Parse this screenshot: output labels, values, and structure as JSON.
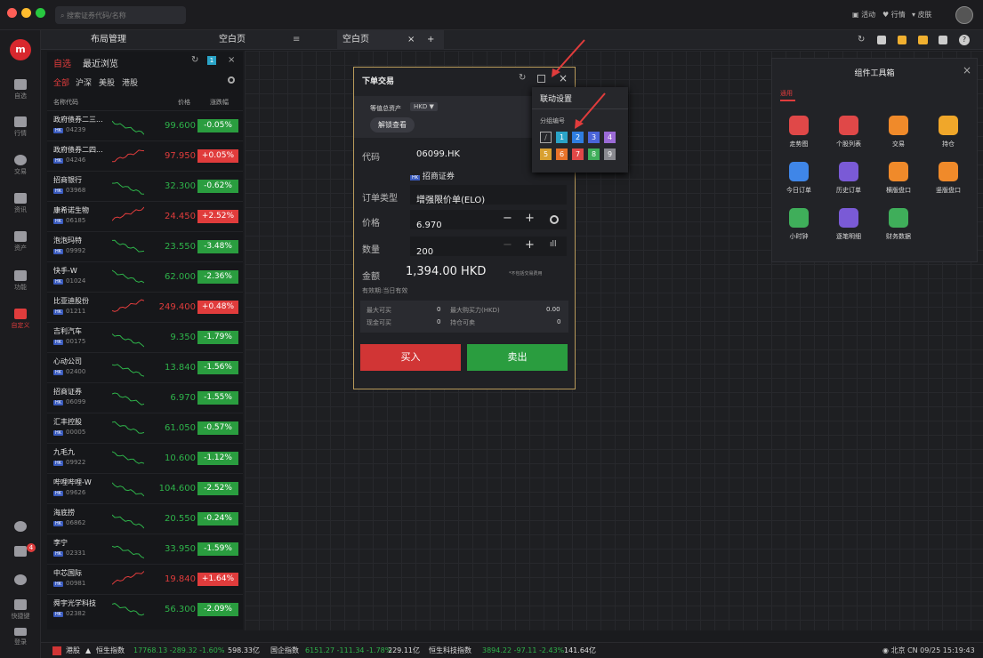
{
  "titlebar": {
    "search_placeholder": "搜索证券代码/名称",
    "menu": [
      "活动",
      "行情",
      "皮肤"
    ]
  },
  "sidebar": {
    "items": [
      "自选",
      "行情",
      "交易",
      "资讯",
      "资产",
      "功能",
      "自定义"
    ],
    "bottom": [
      "快捷键",
      "登录"
    ],
    "badge": "4"
  },
  "tabs": {
    "items": [
      "布局管理",
      "空白页",
      "空白页"
    ],
    "add": "+",
    "close": "×"
  },
  "watchlist": {
    "tabs": [
      "自选",
      "最近浏览"
    ],
    "markets": [
      "全部",
      "沪深",
      "美股",
      "港股"
    ],
    "headers": {
      "name": "名称代码",
      "price": "价格",
      "change": "涨跌幅"
    },
    "market_tag": "HK",
    "rows": [
      {
        "name": "政府债券二三...",
        "code": "04239",
        "price": "99.600",
        "change": "-0.05%",
        "dir": "dn"
      },
      {
        "name": "政府债券二四...",
        "code": "04246",
        "price": "97.950",
        "change": "+0.05%",
        "dir": "up"
      },
      {
        "name": "招商银行",
        "code": "03968",
        "price": "32.300",
        "change": "-0.62%",
        "dir": "dn"
      },
      {
        "name": "康希诺生物",
        "code": "06185",
        "price": "24.450",
        "change": "+2.52%",
        "dir": "up"
      },
      {
        "name": "泡泡玛特",
        "code": "09992",
        "price": "23.550",
        "change": "-3.48%",
        "dir": "dn"
      },
      {
        "name": "快手-W",
        "code": "01024",
        "price": "62.000",
        "change": "-2.36%",
        "dir": "dn"
      },
      {
        "name": "比亚迪股份",
        "code": "01211",
        "price": "249.400",
        "change": "+0.48%",
        "dir": "up"
      },
      {
        "name": "吉利汽车",
        "code": "00175",
        "price": "9.350",
        "change": "-1.79%",
        "dir": "dn"
      },
      {
        "name": "心动公司",
        "code": "02400",
        "price": "13.840",
        "change": "-1.56%",
        "dir": "dn"
      },
      {
        "name": "招商证券",
        "code": "06099",
        "price": "6.970",
        "change": "-1.55%",
        "dir": "dn"
      },
      {
        "name": "汇丰控股",
        "code": "00005",
        "price": "61.050",
        "change": "-0.57%",
        "dir": "dn"
      },
      {
        "name": "九毛九",
        "code": "09922",
        "price": "10.600",
        "change": "-1.12%",
        "dir": "dn"
      },
      {
        "name": "哔哩哔哩-W",
        "code": "09626",
        "price": "104.600",
        "change": "-2.52%",
        "dir": "dn"
      },
      {
        "name": "海底捞",
        "code": "06862",
        "price": "20.550",
        "change": "-0.24%",
        "dir": "dn"
      },
      {
        "name": "李宁",
        "code": "02331",
        "price": "33.950",
        "change": "-1.59%",
        "dir": "dn"
      },
      {
        "name": "中芯国际",
        "code": "00981",
        "price": "19.840",
        "change": "+1.64%",
        "dir": "up"
      },
      {
        "name": "舜宇光学科技",
        "code": "02382",
        "price": "56.300",
        "change": "-2.09%",
        "dir": "dn"
      }
    ]
  },
  "order": {
    "title": "下单交易",
    "asset_label": "等值总资产",
    "currency": "HKD ▼",
    "unlock": "解锁查看",
    "code_label": "代码",
    "code": "06099.HK",
    "stock_name": "招商证券",
    "type_label": "订单类型",
    "type": "增强限价单(ELO)",
    "price_label": "价格",
    "price": "6.970",
    "qty_label": "数量",
    "qty": "200",
    "amount_label": "金额",
    "amount": "1,394.00 HKD",
    "fee_note": "*不包括交易费用",
    "validity": "有效期:当日有效",
    "max_buy_label": "最大可买",
    "max_buy": "0",
    "buying_power_label": "最大购买力(HKD)",
    "buying_power": "0.00",
    "cash_buy_label": "现金可买",
    "cash_buy": "0",
    "hold_sell_label": "持仓可卖",
    "hold_sell": "0",
    "buy": "买入",
    "sell": "卖出",
    "minus": "−",
    "plus": "+"
  },
  "popup": {
    "title": "联动设置",
    "group_label": "分组编号",
    "groups": [
      "1",
      "2",
      "3",
      "4",
      "5",
      "6",
      "7",
      "8",
      "9"
    ],
    "colors": [
      "#2aa3c7",
      "#2f7de0",
      "#4a64d8",
      "#9b6ad6",
      "#d8a030",
      "#e8732a",
      "#e04848",
      "#3fae5a",
      "#8a8a90"
    ]
  },
  "tools": {
    "title": "组件工具箱",
    "tab": "通用",
    "items": [
      {
        "label": "走势图",
        "color": "#e04848"
      },
      {
        "label": "个股列表",
        "color": "#e04848"
      },
      {
        "label": "交易",
        "color": "#f08a2a"
      },
      {
        "label": "持仓",
        "color": "#f0a72a"
      },
      {
        "label": "今日订单",
        "color": "#3f86e8"
      },
      {
        "label": "历史订单",
        "color": "#7a5ad6"
      },
      {
        "label": "横版盘口",
        "color": "#f08a2a"
      },
      {
        "label": "竖版盘口",
        "color": "#f08a2a"
      },
      {
        "label": "小时钟",
        "color": "#3fae5a"
      },
      {
        "label": "逐笔明细",
        "color": "#7a5ad6"
      },
      {
        "label": "财务数据",
        "color": "#3fae5a"
      }
    ]
  },
  "status": {
    "market": "港股",
    "index1_name": "恒生指数",
    "index1": "17768.13 -289.32 -1.60%",
    "index1_vol": "598.33亿",
    "index2_name": "国企指数",
    "index2": "6151.27 -111.34 -1.78%",
    "index2_vol": "229.11亿",
    "index3_name": "恒生科技指数",
    "index3": "3894.22 -97.11 -2.43%",
    "index3_vol": "141.64亿",
    "clock": "北京 CN 09/25 15:19:43"
  }
}
